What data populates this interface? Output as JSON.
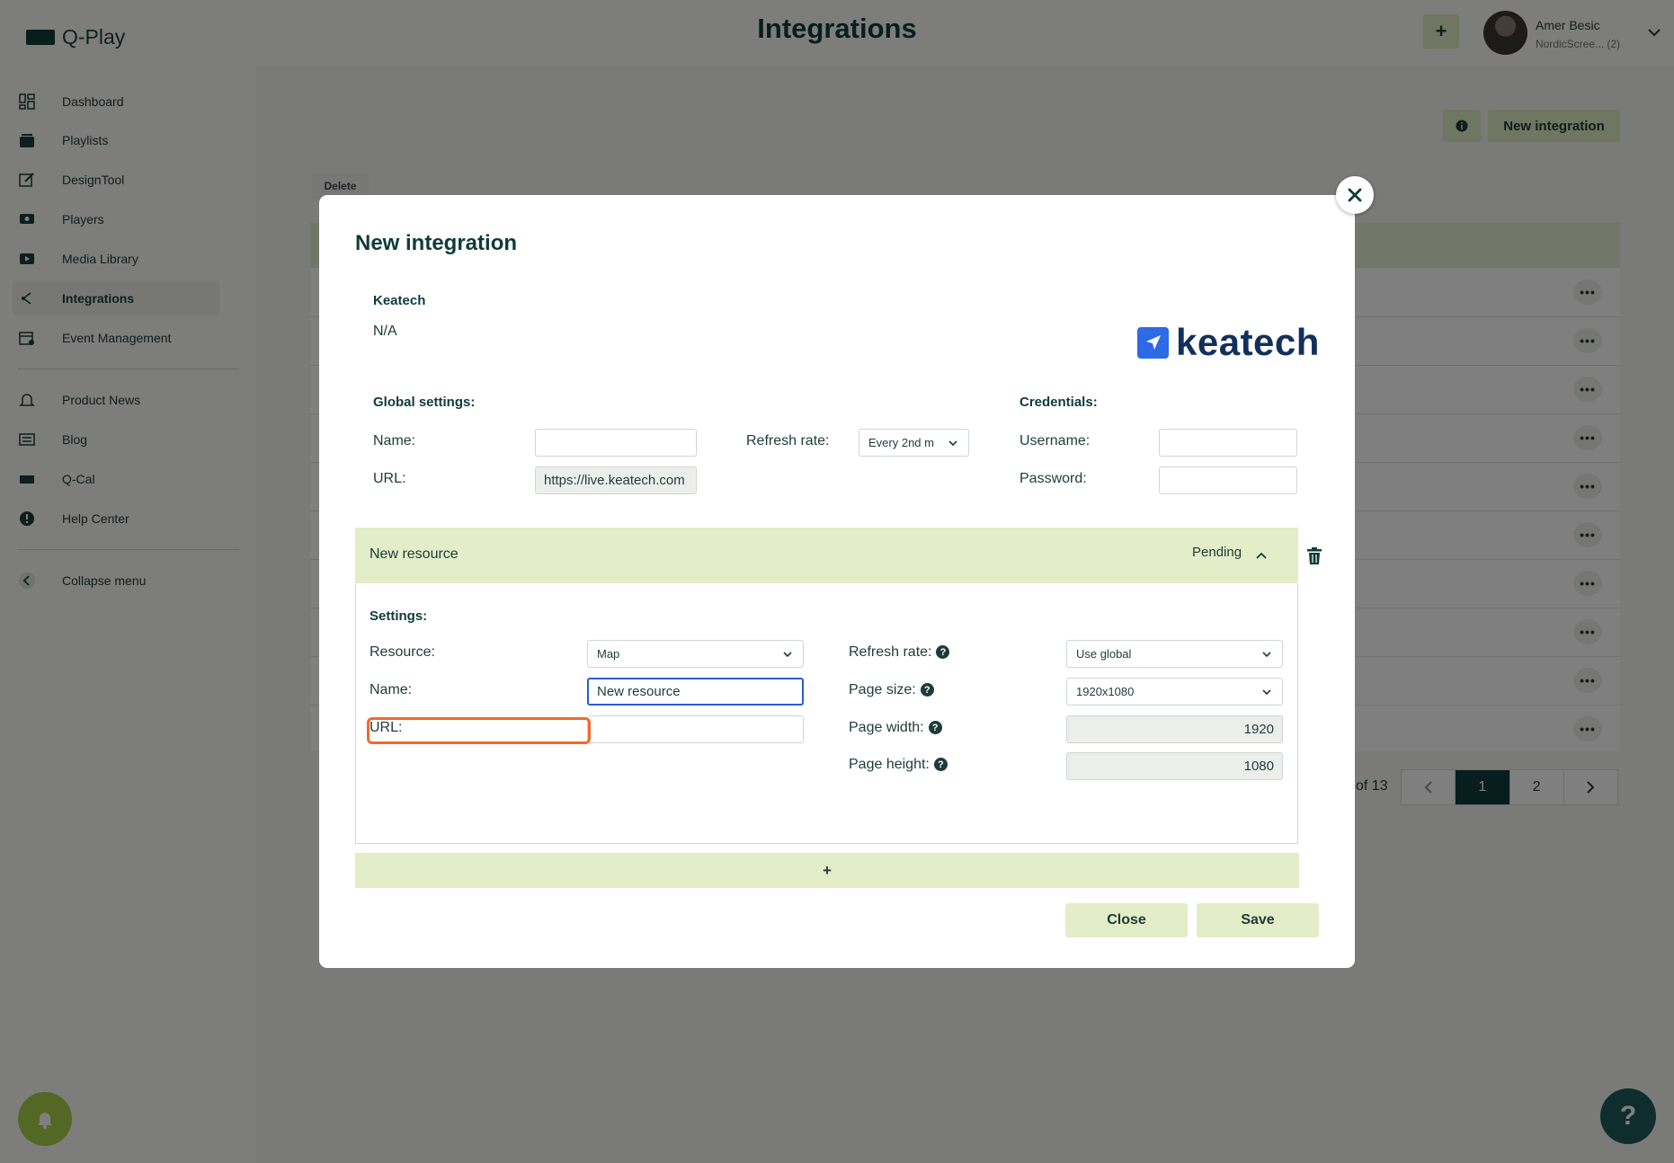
{
  "app": {
    "logo_text": "Q-Play",
    "page_title": "Integrations",
    "top_plus": "+",
    "user_name": "Amer Besic",
    "user_org": "NordicScree... (2)"
  },
  "sidebar": {
    "items": [
      {
        "label": "Dashboard",
        "icon": "dashboard-icon"
      },
      {
        "label": "Playlists",
        "icon": "playlists-icon"
      },
      {
        "label": "DesignTool",
        "icon": "design-tool-icon"
      },
      {
        "label": "Players",
        "icon": "players-icon"
      },
      {
        "label": "Media Library",
        "icon": "media-library-icon"
      },
      {
        "label": "Integrations",
        "icon": "integrations-icon",
        "active": true
      },
      {
        "label": "Event Management",
        "icon": "event-management-icon"
      },
      {
        "label": "Product News",
        "icon": "product-news-icon"
      },
      {
        "label": "Blog",
        "icon": "blog-icon"
      },
      {
        "label": "Q-Cal",
        "icon": "q-cal-icon"
      },
      {
        "label": "Help Center",
        "icon": "help-center-icon"
      },
      {
        "label": "Collapse menu",
        "icon": "collapse-menu-icon"
      }
    ]
  },
  "main": {
    "new_integration_button": "New integration",
    "delete_tab": "Delete",
    "row_menu": "•••",
    "pagination": {
      "of_text": "of 13",
      "pages": [
        "1",
        "2"
      ],
      "current": "1"
    }
  },
  "modal": {
    "title": "New integration",
    "provider_name": "Keatech",
    "provider_value": "N/A",
    "brand_text": "keatech",
    "global": {
      "heading": "Global settings:",
      "name_label": "Name:",
      "name_value": "",
      "url_label": "URL:",
      "url_value": "https://live.keatech.com",
      "refresh_label": "Refresh rate:",
      "refresh_value": "Every 2nd m"
    },
    "credentials": {
      "heading": "Credentials:",
      "username_label": "Username:",
      "username_value": "",
      "password_label": "Password:",
      "password_value": ""
    },
    "resource": {
      "title": "New resource",
      "status": "Pending",
      "settings_heading": "Settings:",
      "resource_label": "Resource:",
      "resource_value": "Map",
      "name_label": "Name:",
      "name_value": "New resource",
      "url_label": "URL:",
      "url_value": "",
      "refresh_label": "Refresh rate:",
      "refresh_value": "Use global",
      "page_size_label": "Page size:",
      "page_size_value": "1920x1080",
      "page_width_label": "Page width:",
      "page_width_value": "1920",
      "page_height_label": "Page height:",
      "page_height_value": "1080"
    },
    "add_resource": "+",
    "close_button": "Close",
    "save_button": "Save"
  },
  "colors": {
    "accent": "#e3edc7",
    "dark": "#103b3a",
    "highlight": "#f06a2c",
    "focus": "#2d5bd0",
    "brand": "#2c6ae6"
  }
}
